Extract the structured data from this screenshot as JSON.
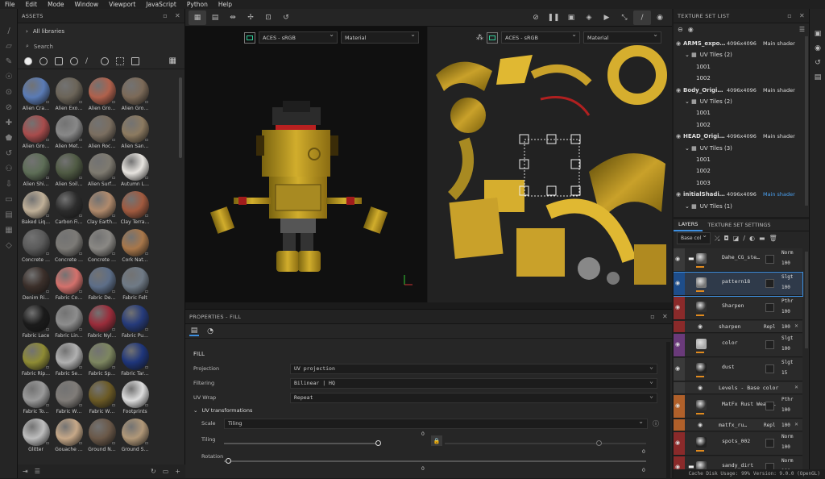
{
  "menu": [
    "File",
    "Edit",
    "Mode",
    "Window",
    "Viewport",
    "JavaScript",
    "Python",
    "Help"
  ],
  "assets": {
    "title": "ASSETS",
    "libraries": "All libraries",
    "search_placeholder": "Search",
    "items": [
      [
        "Alien Cra…",
        "#5a7bb5"
      ],
      [
        "Alien Exo…",
        "#6b6458"
      ],
      [
        "Alien Gro…",
        "#b0614c"
      ],
      [
        "Alien Gro…",
        "#7c6a58"
      ],
      [
        "Alien Gro…",
        "#a84c4c"
      ],
      [
        "Alien Met…",
        "#888888"
      ],
      [
        "Alien Roc…",
        "#7a6e60"
      ],
      [
        "Alien San…",
        "#8c7a60"
      ],
      [
        "Alien Shi…",
        "#5e6e57"
      ],
      [
        "Alien Soil…",
        "#4f5a43"
      ],
      [
        "Alien Surf…",
        "#7e7a70"
      ],
      [
        "Autumn L…",
        "#e7e4df"
      ],
      [
        "Baked Liq…",
        "#c0b098"
      ],
      [
        "Carbon Fi…",
        "#2c2c2c"
      ],
      [
        "Clay Earth…",
        "#b08a6c"
      ],
      [
        "Clay Terra…",
        "#a15a3f"
      ],
      [
        "Concrete …",
        "#5a5a5a"
      ],
      [
        "Concrete …",
        "#7c7a76"
      ],
      [
        "Concrete …",
        "#8a8884"
      ],
      [
        "Cork Nat…",
        "#a8774a"
      ],
      [
        "Denim Ri…",
        "#3b2f2a"
      ],
      [
        "Fabric Co…",
        "#d4716c"
      ],
      [
        "Fabric De…",
        "#5d6e88"
      ],
      [
        "Fabric Felt",
        "#6f7a86"
      ],
      [
        "Fabric Lace",
        "#1b1b1b"
      ],
      [
        "Fabric Lin…",
        "#8d8d8d"
      ],
      [
        "Fabric Nyl…",
        "#9a2c3a"
      ],
      [
        "Fabric Pu…",
        "#253a7a"
      ],
      [
        "Fabric Rip…",
        "#8e8b34"
      ],
      [
        "Fabric Se…",
        "#b0b0b0"
      ],
      [
        "Fabric Sp…",
        "#7d8660"
      ],
      [
        "Fabric Tar…",
        "#1e357a"
      ],
      [
        "Fabric To…",
        "#9a9a9a"
      ],
      [
        "Fabric W…",
        "#807c78"
      ],
      [
        "Fabric W…",
        "#6b5a25"
      ],
      [
        "Footprints",
        "#dddddd"
      ],
      [
        "Glitter",
        "#bdbdbd"
      ],
      [
        "Gouache …",
        "#c6a888"
      ],
      [
        "Ground N…",
        "#6a5848"
      ],
      [
        "Ground S…",
        "#b19878"
      ]
    ]
  },
  "toolbar": {
    "icons": [
      "grid-view",
      "quad-view",
      "symmetry",
      "axis",
      "frame",
      "history"
    ],
    "right_icons": [
      "hide",
      "pause",
      "display",
      "cube",
      "camera",
      "brush",
      "screenshot"
    ]
  },
  "viewport3d": {
    "colorspace": "ACES - sRGB",
    "channel": "Material"
  },
  "viewport2d": {
    "colorspace": "ACES - sRGB",
    "channel": "Material"
  },
  "properties": {
    "title": "PROPERTIES - FILL",
    "section": "FILL",
    "rows": [
      {
        "label": "Projection",
        "value": "UV projection"
      },
      {
        "label": "Filtering",
        "value": "Bilinear | HQ"
      },
      {
        "label": "UV Wrap",
        "value": "Repeat"
      }
    ],
    "uv_title": "UV transformations",
    "scale_label": "Scale",
    "scale_value": "Tiling",
    "tiling_label": "Tiling",
    "tiling_value": "0",
    "tiling_x": "0",
    "rotation_label": "Rotation",
    "rotation_value": "0",
    "rotation_x": "0"
  },
  "texture_set_list": {
    "title": "TEXTURE SET LIST",
    "rows": [
      {
        "name": "ARMS_expo…",
        "res": "4096x4096",
        "shader": "Main shader",
        "type": "set"
      },
      {
        "name": "UV Tiles (2)",
        "type": "tiles"
      },
      {
        "name": "1001",
        "type": "tile"
      },
      {
        "name": "1002",
        "type": "tile"
      },
      {
        "name": "Body_Origi…",
        "res": "4096x4096",
        "shader": "Main shader",
        "type": "set"
      },
      {
        "name": "UV Tiles (2)",
        "type": "tiles"
      },
      {
        "name": "1001",
        "type": "tile"
      },
      {
        "name": "1002",
        "type": "tile"
      },
      {
        "name": "HEAD_Origi…",
        "res": "4096x4096",
        "shader": "Main shader",
        "type": "set"
      },
      {
        "name": "UV Tiles (3)",
        "type": "tiles"
      },
      {
        "name": "1001",
        "type": "tile"
      },
      {
        "name": "1002",
        "type": "tile"
      },
      {
        "name": "1003",
        "type": "tile"
      },
      {
        "name": "initialShadi…",
        "res": "4096x4096",
        "shader": "Main shader",
        "type": "set",
        "highlight": true
      },
      {
        "name": "UV Tiles (1)",
        "type": "tiles"
      }
    ]
  },
  "layers": {
    "tabs": [
      "LAYERS",
      "TEXTURE SET SETTINGS"
    ],
    "channel": "Base col",
    "items": [
      {
        "name": "Dahe_CG_ste…",
        "blend": "Norm",
        "op": "100",
        "color": "#3a3a3a",
        "thumb": "#555",
        "folder": true
      },
      {
        "name": "pattern18",
        "blend": "Slgt",
        "op": "100",
        "color": "#1e4d8a",
        "thumb": "#777",
        "selected": true
      },
      {
        "name": "Sharpen",
        "blend": "Pthr",
        "op": "100",
        "color": "#8a2a2a",
        "thumb": "#333"
      },
      {
        "name": "sharpen",
        "blend": "Repl",
        "op": "100",
        "color": "#8a2a2a",
        "sub": true
      },
      {
        "name": "color",
        "blend": "Slgt",
        "op": "100",
        "color": "#6a3a7a",
        "thumb": "#aaa"
      },
      {
        "name": "dust",
        "blend": "Slgt",
        "op": "15",
        "color": "#3a3a3a",
        "thumb": "#222"
      },
      {
        "name": "Levels - Base color",
        "blend": "",
        "op": "",
        "color": "#3a3a3a",
        "sub": true
      },
      {
        "name": "MatFx Rust Weath…",
        "blend": "Pthr",
        "op": "100",
        "color": "#b0602a",
        "thumb": "#333"
      },
      {
        "name": "matfx_ru…",
        "blend": "Repl",
        "op": "100",
        "color": "#b0602a",
        "sub": true
      },
      {
        "name": "spots_002",
        "blend": "Norm",
        "op": "100",
        "color": "#8a2a2a",
        "thumb": "#222"
      },
      {
        "name": "sandy_dirt",
        "blend": "Norm",
        "op": "100",
        "color": "#8a2a2a",
        "thumb": "#444",
        "folder": true
      }
    ]
  },
  "status": {
    "cache": "Cache Disk Usage:",
    "cache_pct": "99%",
    "version": "Version: 9.0.0 (OpenGL)"
  }
}
